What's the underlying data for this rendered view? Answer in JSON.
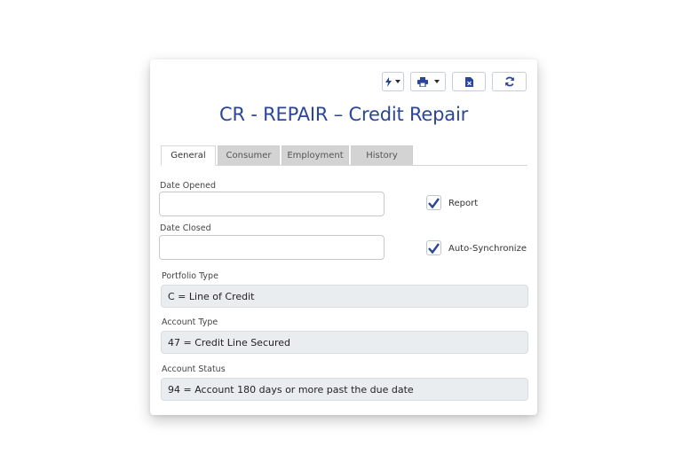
{
  "toolbar": {
    "actions_icon": "lightning-icon",
    "print_icon": "printer-icon",
    "export_icon": "excel-file-icon",
    "refresh_icon": "refresh-icon"
  },
  "title": "CR - REPAIR – Credit Repair",
  "tabs": [
    {
      "label": "General",
      "active": true
    },
    {
      "label": "Consumer",
      "active": false
    },
    {
      "label": "Employment",
      "active": false
    },
    {
      "label": "History",
      "active": false
    }
  ],
  "form": {
    "date_opened": {
      "label": "Date Opened",
      "value": ""
    },
    "date_closed": {
      "label": "Date Closed",
      "value": ""
    },
    "report": {
      "label": "Report",
      "checked": true
    },
    "auto_sync": {
      "label": "Auto-Synchronize",
      "checked": true
    },
    "portfolio_type": {
      "label": "Portfolio Type",
      "value": "C = Line of Credit"
    },
    "account_type": {
      "label": "Account Type",
      "value": "47 = Credit Line Secured"
    },
    "account_status": {
      "label": "Account Status",
      "value": "94 = Account 180 days or more past the due date"
    }
  },
  "colors": {
    "accent": "#2b4699",
    "readonly_bg": "#e9edf0"
  }
}
